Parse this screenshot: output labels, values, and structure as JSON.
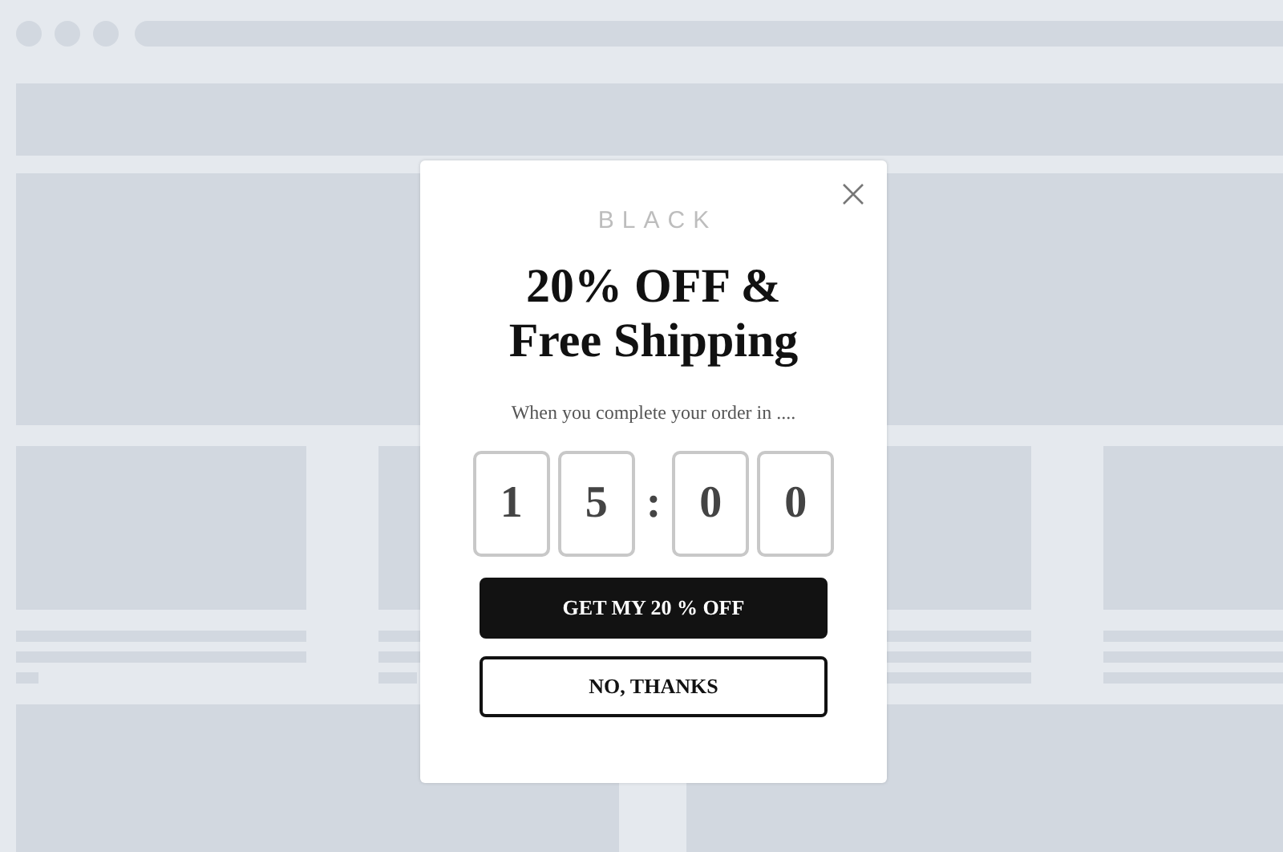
{
  "popup": {
    "brand": "BLACK",
    "headline": [
      "20% OFF &",
      "Free Shipping"
    ],
    "subtitle": "When you complete your order in ....",
    "countdown": [
      {
        "kind": "digit",
        "text": "1"
      },
      {
        "kind": "digit",
        "text": "5"
      },
      {
        "kind": "separator",
        "text": ":"
      },
      {
        "kind": "digit",
        "text": "0"
      },
      {
        "kind": "digit",
        "text": "0"
      }
    ],
    "buttons": [
      {
        "kind": "primary",
        "label": "GET MY 20 % OFF"
      },
      {
        "kind": "secondary",
        "label": "NO, THANKS"
      }
    ]
  }
}
